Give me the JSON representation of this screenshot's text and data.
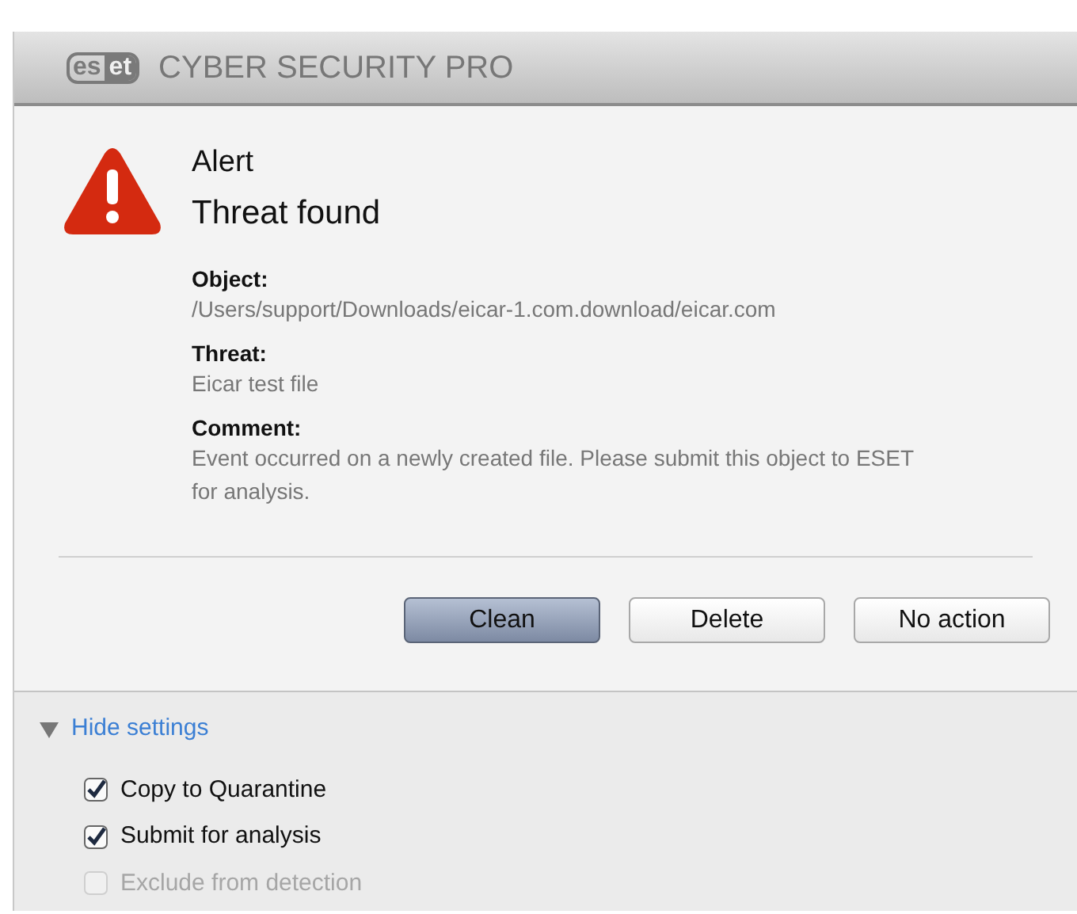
{
  "header": {
    "logo": [
      "es",
      "et"
    ],
    "title": "CYBER SECURITY PRO"
  },
  "alert": {
    "heading": "Alert",
    "title": "Threat found"
  },
  "details": [
    {
      "label": "Object:",
      "value": "/Users/support/Downloads/eicar-1.com.download/eicar.com"
    },
    {
      "label": "Threat:",
      "value": "Eicar test file"
    },
    {
      "label": "Comment:",
      "value": "Event occurred on a newly created file. Please submit this object to ESET for analysis."
    }
  ],
  "buttons": [
    {
      "label": "Clean",
      "default": true
    },
    {
      "label": "Delete",
      "default": false
    },
    {
      "label": "No action",
      "default": false
    }
  ],
  "settings": {
    "toggle": "Hide settings",
    "expanded": true,
    "options": [
      {
        "label": "Copy to Quarantine",
        "checked": true,
        "disabled": false
      },
      {
        "label": "Submit for analysis",
        "checked": true,
        "disabled": false
      },
      {
        "label": "Exclude from detection",
        "checked": false,
        "disabled": true
      }
    ]
  }
}
